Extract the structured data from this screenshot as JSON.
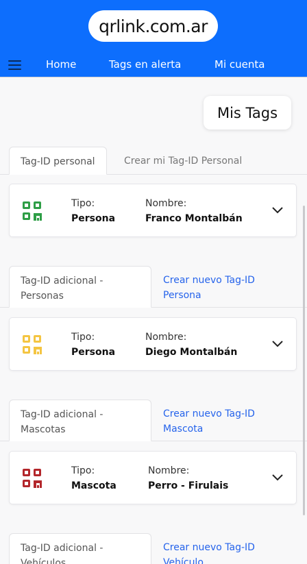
{
  "header": {
    "logo": "qrlink.com.ar",
    "nav": [
      {
        "label": "Home"
      },
      {
        "label": "Tags en alerta"
      },
      {
        "label": "Mi cuenta"
      }
    ]
  },
  "page_title": "Mis Tags",
  "sections": [
    {
      "tab_active": "Tag-ID personal",
      "tab_other": "Crear mi Tag-ID Personal",
      "card": {
        "tipo_label": "Tipo:",
        "tipo": "Persona",
        "nombre_label": "Nombre:",
        "nombre": "Franco Montalbán",
        "icon_color": "#2e9e46"
      }
    },
    {
      "tab_active_l1": "Tag-ID adicional -",
      "tab_active_l2": "Personas",
      "tab_link_l1": "Crear nuevo Tag-ID",
      "tab_link_l2": "Persona",
      "card": {
        "tipo_label": "Tipo:",
        "tipo": "Persona",
        "nombre_label": "Nombre:",
        "nombre": "Diego Montalbán",
        "icon_color": "#f4c542"
      }
    },
    {
      "tab_active_l1": "Tag-ID adicional -",
      "tab_active_l2": "Mascotas",
      "tab_link_l1": "Crear nuevo Tag-ID",
      "tab_link_l2": "Mascota",
      "card": {
        "tipo_label": "Tipo:",
        "tipo": "Mascota",
        "nombre_label": "Nombre:",
        "nombre": "Perro - Firulais",
        "icon_color": "#b3262b"
      }
    },
    {
      "tab_active_l1": "Tag-ID adicional -",
      "tab_active_l2": "Vehículos",
      "tab_link_l1": "Crear nuevo Tag-ID",
      "tab_link_l2": "Vehículo"
    }
  ],
  "colors": {
    "brand": "#0d6efd",
    "link": "#2563eb"
  }
}
